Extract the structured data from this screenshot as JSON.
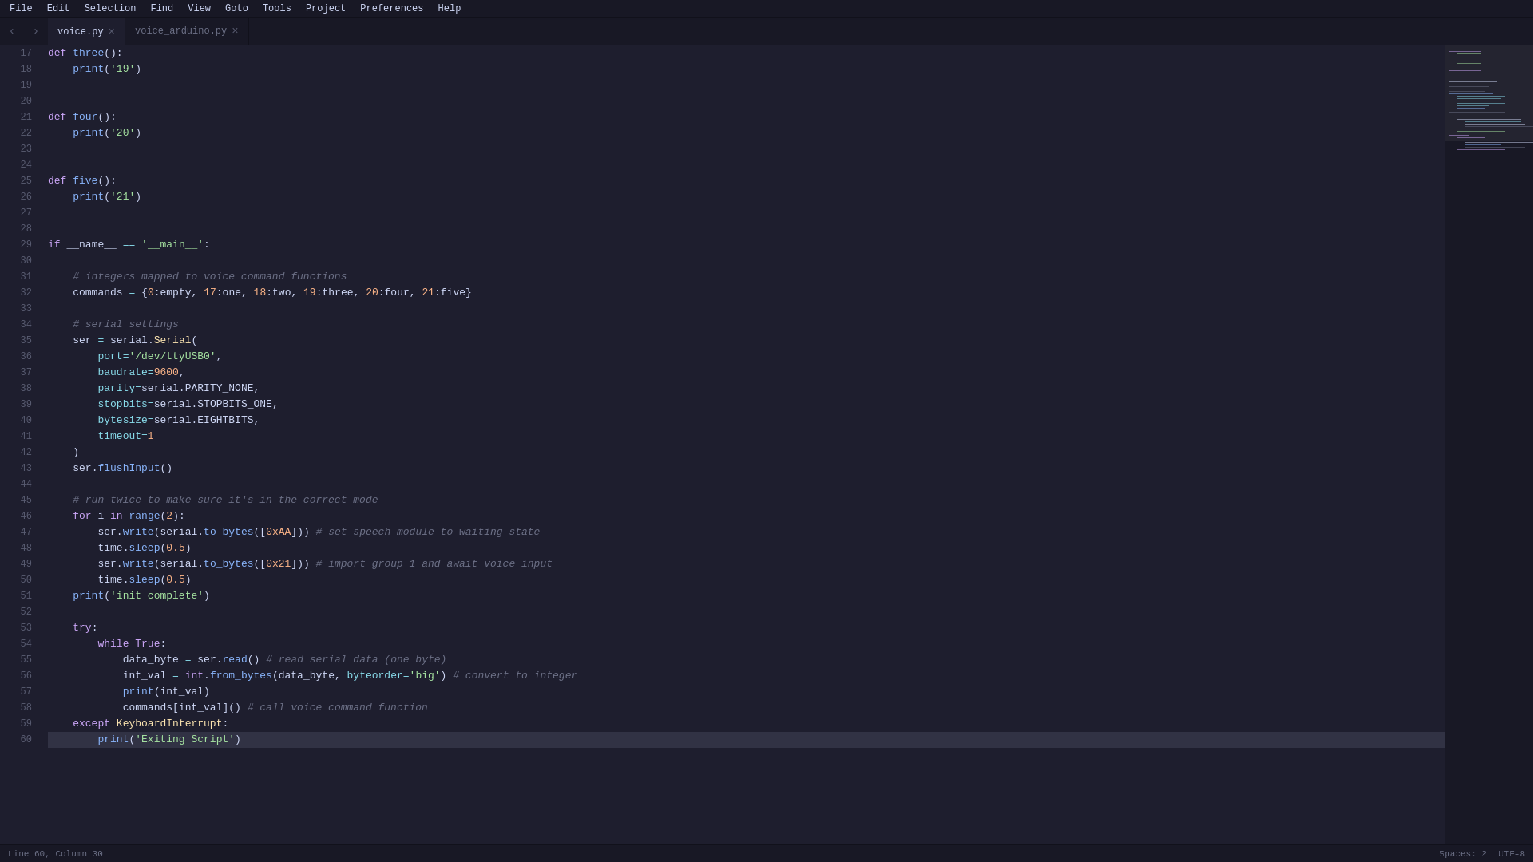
{
  "menubar": {
    "items": [
      "File",
      "Edit",
      "Selection",
      "Find",
      "View",
      "Goto",
      "Tools",
      "Project",
      "Preferences",
      "Help"
    ]
  },
  "tabbar": {
    "tabs": [
      {
        "label": "voice.py",
        "active": true
      },
      {
        "label": "voice_arduino.py",
        "active": false
      }
    ]
  },
  "editor": {
    "lines": [
      {
        "num": 17,
        "code": "def three():"
      },
      {
        "num": 18,
        "code": "    print('19')"
      },
      {
        "num": 19,
        "code": ""
      },
      {
        "num": 20,
        "code": ""
      },
      {
        "num": 21,
        "code": "def four():"
      },
      {
        "num": 22,
        "code": "    print('20')"
      },
      {
        "num": 23,
        "code": ""
      },
      {
        "num": 24,
        "code": ""
      },
      {
        "num": 25,
        "code": "def five():"
      },
      {
        "num": 26,
        "code": "    print('21')"
      },
      {
        "num": 27,
        "code": ""
      },
      {
        "num": 28,
        "code": ""
      },
      {
        "num": 29,
        "code": "if __name__ == '__main__':"
      },
      {
        "num": 30,
        "code": ""
      },
      {
        "num": 31,
        "code": "    # integers mapped to voice command functions"
      },
      {
        "num": 32,
        "code": "    commands = {0:empty, 17:one, 18:two, 19:three, 20:four, 21:five}"
      },
      {
        "num": 33,
        "code": ""
      },
      {
        "num": 34,
        "code": "    # serial settings"
      },
      {
        "num": 35,
        "code": "    ser = serial.Serial("
      },
      {
        "num": 36,
        "code": "        port='/dev/ttyUSB0',"
      },
      {
        "num": 37,
        "code": "        baudrate=9600,"
      },
      {
        "num": 38,
        "code": "        parity=serial.PARITY_NONE,"
      },
      {
        "num": 39,
        "code": "        stopbits=serial.STOPBITS_ONE,"
      },
      {
        "num": 40,
        "code": "        bytesize=serial.EIGHTBITS,"
      },
      {
        "num": 41,
        "code": "        timeout=1"
      },
      {
        "num": 42,
        "code": "    )"
      },
      {
        "num": 43,
        "code": "    ser.flushInput()"
      },
      {
        "num": 44,
        "code": ""
      },
      {
        "num": 45,
        "code": "    # run twice to make sure it's in the correct mode"
      },
      {
        "num": 46,
        "code": "    for i in range(2):"
      },
      {
        "num": 47,
        "code": "        ser.write(serial.to_bytes([0xAA])) # set speech module to waiting state"
      },
      {
        "num": 48,
        "code": "        time.sleep(0.5)"
      },
      {
        "num": 49,
        "code": "        ser.write(serial.to_bytes([0x21])) # import group 1 and await voice input"
      },
      {
        "num": 50,
        "code": "        time.sleep(0.5)"
      },
      {
        "num": 51,
        "code": "    print('init complete')"
      },
      {
        "num": 52,
        "code": ""
      },
      {
        "num": 53,
        "code": "    try:"
      },
      {
        "num": 54,
        "code": "        while True:"
      },
      {
        "num": 55,
        "code": "            data_byte = ser.read() # read serial data (one byte)"
      },
      {
        "num": 56,
        "code": "            int_val = int.from_bytes(data_byte, byteorder='big') # convert to integer"
      },
      {
        "num": 57,
        "code": "            print(int_val)"
      },
      {
        "num": 58,
        "code": "            commands[int_val]() # call voice command function"
      },
      {
        "num": 59,
        "code": "    except KeyboardInterrupt:"
      },
      {
        "num": 60,
        "code": "        print('Exiting Script')"
      }
    ]
  },
  "statusbar": {
    "left": [
      "Line 60, Column 30"
    ],
    "right": [
      "Spaces: 2",
      "UTF-8"
    ]
  }
}
